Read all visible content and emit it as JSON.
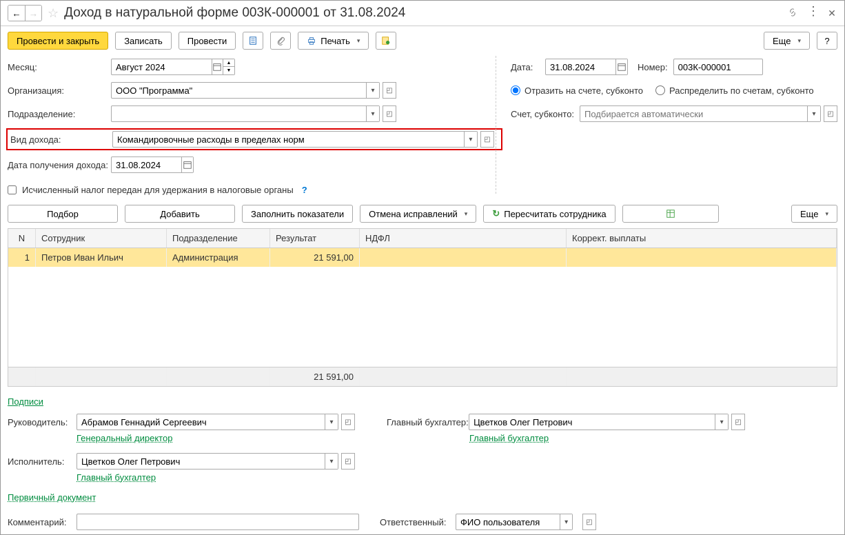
{
  "title": "Доход в натуральной форме 003К-000001 от 31.08.2024",
  "toolbar": {
    "post_close": "Провести и закрыть",
    "save": "Записать",
    "post": "Провести",
    "print": "Печать",
    "more": "Еще"
  },
  "form": {
    "month_label": "Месяц:",
    "month_value": "Август 2024",
    "org_label": "Организация:",
    "org_value": "ООО \"Программа\"",
    "dep_label": "Подразделение:",
    "dep_value": "",
    "income_type_label": "Вид дохода:",
    "income_type_value": "Командировочные расходы в пределах норм",
    "income_date_label": "Дата получения дохода:",
    "income_date_value": "31.08.2024",
    "date_label": "Дата:",
    "date_value": "31.08.2024",
    "number_label": "Номер:",
    "number_value": "003К-000001",
    "radio1": "Отразить на счете, субконто",
    "radio2": "Распределить по счетам, субконто",
    "account_label": "Счет, субконто:",
    "account_placeholder": "Подбирается автоматически",
    "checkbox_label": "Исчисленный налог передан для удержания в налоговые органы"
  },
  "cmdbar": {
    "selection": "Подбор",
    "add": "Добавить",
    "fill": "Заполнить показатели",
    "cancel_corr": "Отмена исправлений",
    "recalc": "Пересчитать сотрудника",
    "more": "Еще"
  },
  "table": {
    "headers": {
      "n": "N",
      "emp": "Сотрудник",
      "dep": "Подразделение",
      "res": "Результат",
      "ndfl": "НДФЛ",
      "corr": "Коррект. выплаты"
    },
    "rows": [
      {
        "n": "1",
        "emp": "Петров Иван Ильич",
        "dep": "Администрация",
        "res": "21 591,00",
        "ndfl": "",
        "corr": ""
      }
    ],
    "footer_res": "21 591,00"
  },
  "signatures": {
    "title": "Подписи",
    "mgr_label": "Руководитель:",
    "mgr_value": "Абрамов Геннадий Сергеевич",
    "mgr_position": "Генеральный директор",
    "acc_label": "Главный бухгалтер:",
    "acc_value": "Цветков Олег Петрович",
    "acc_position": "Главный бухгалтер",
    "exec_label": "Исполнитель:",
    "exec_value": "Цветков Олег Петрович",
    "exec_position": "Главный бухгалтер"
  },
  "footer": {
    "doc_link": "Первичный документ",
    "comment_label": "Комментарий:",
    "comment_value": "",
    "responsible_label": "Ответственный:",
    "responsible_value": "ФИО пользователя"
  }
}
